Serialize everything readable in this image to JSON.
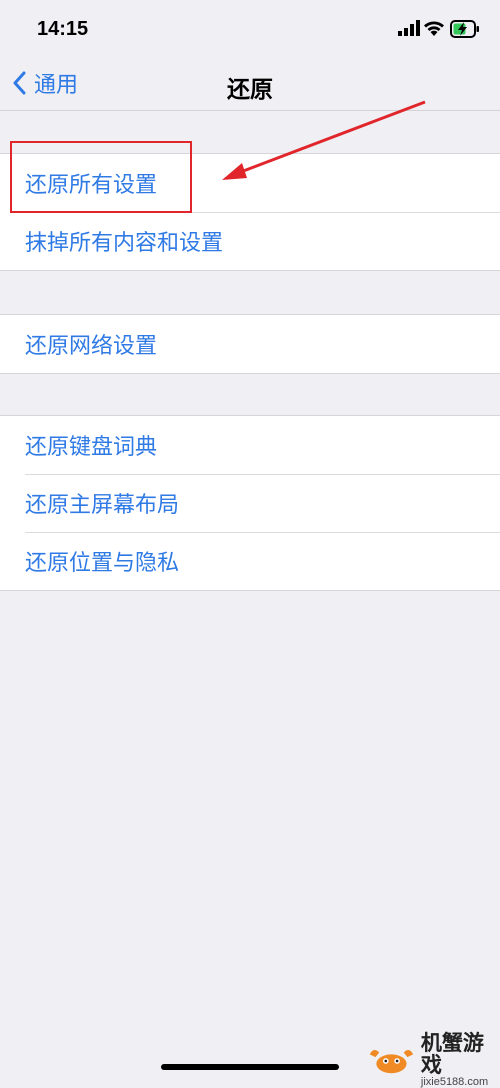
{
  "status_bar": {
    "time": "14:15"
  },
  "nav": {
    "back_label": "通用",
    "title": "还原"
  },
  "groups": [
    {
      "items": [
        "还原所有设置",
        "抹掉所有内容和设置"
      ]
    },
    {
      "items": [
        "还原网络设置"
      ]
    },
    {
      "items": [
        "还原键盘词典",
        "还原主屏幕布局",
        "还原位置与隐私"
      ]
    }
  ],
  "colors": {
    "accent": "#2f7ae5",
    "annotation": "#e0262b",
    "background": "#efeff4"
  },
  "watermark": {
    "title": "机蟹游戏",
    "url": "jixie5188.com"
  }
}
